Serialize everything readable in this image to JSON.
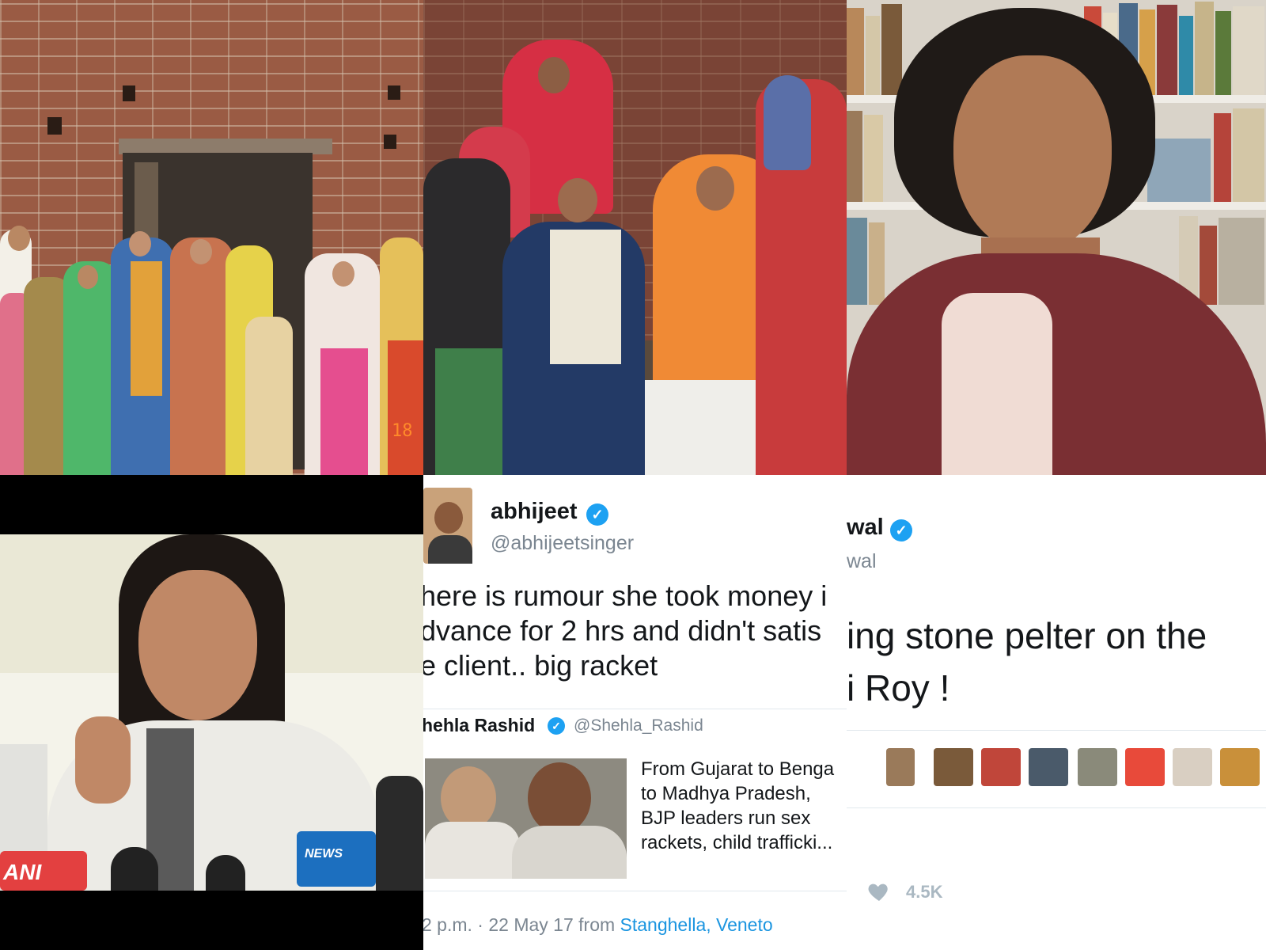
{
  "collage": {
    "panel1": {
      "date_stamp": "18"
    },
    "panel4": {
      "mic_ani": "ANI",
      "mic_news": "NEWS"
    },
    "panel5": {
      "display_name": "abhijeet",
      "handle": "@abhijeetsinger",
      "body_lines": [
        "here is rumour she took money i",
        "dvance for 2 hrs and didn't satis",
        "e client.. big racket"
      ],
      "quoted_name": "hehla Rashid",
      "quoted_handle": "@Shehla_Rashid",
      "quoted_lines": [
        "From Gujarat to Benga",
        "to Madhya Pradesh,",
        "BJP leaders run sex",
        "rackets, child trafficki..."
      ],
      "meta_time": "2 p.m. · 22 May 17",
      "meta_from": "from",
      "meta_place": "Stanghella, Veneto"
    },
    "panel6": {
      "display_name": "wal",
      "handle": "wal",
      "body_lines": [
        "ing stone pelter on the",
        "i Roy !"
      ],
      "likes": "4.5K"
    }
  },
  "colors": {
    "verified": "#1da1f2",
    "link": "#1b95e0",
    "date_stamp": "#ff8a2a",
    "meta_gray": "#7b8691"
  },
  "icons": [
    "verified-badge-icon",
    "heart-icon"
  ]
}
